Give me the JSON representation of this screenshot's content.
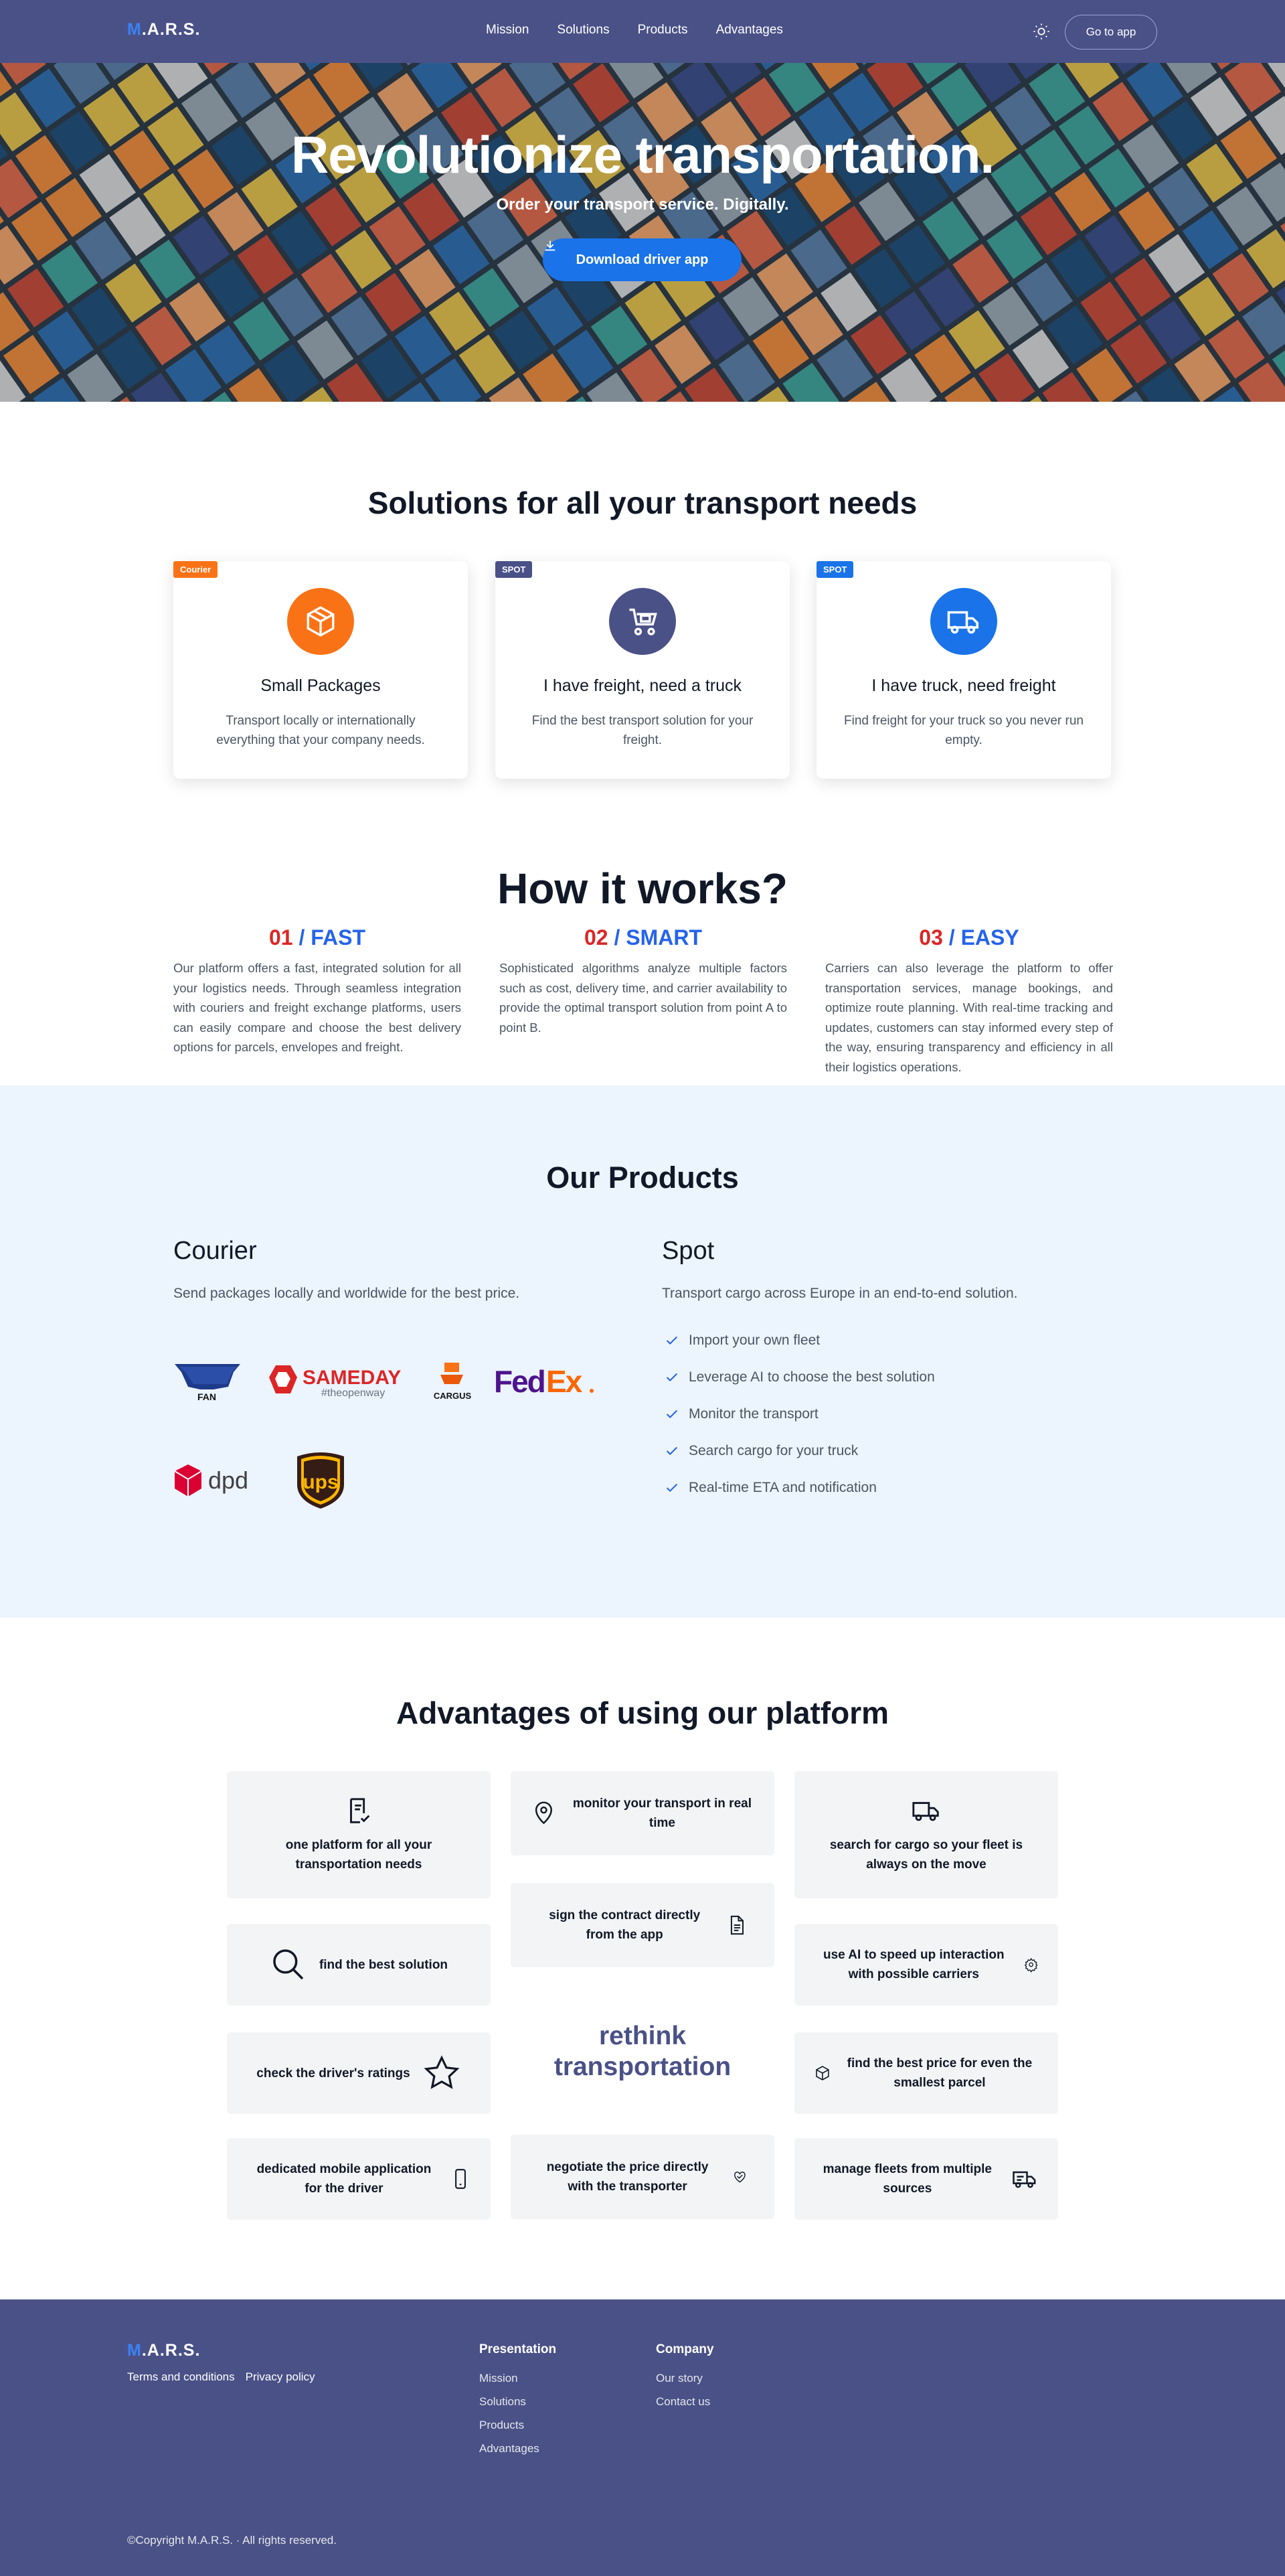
{
  "nav": {
    "logo_prefix": "M",
    "logo_rest": ".A.R.S.",
    "links": [
      "Mission",
      "Solutions",
      "Products",
      "Advantages"
    ],
    "theme_icon": "sun-icon",
    "cta": "Go to app"
  },
  "hero": {
    "title": "Revolutionize transportation.",
    "subtitle": "Order your transport service. Digitally.",
    "button": "Download driver app"
  },
  "solutions": {
    "title": "Solutions for all your transport needs",
    "cards": [
      {
        "badge": "Courier",
        "badge_color": "#f97316",
        "circle_color": "#f97316",
        "icon": "package-icon",
        "title": "Small Packages",
        "text": "Transport locally or internationally everything that your company needs."
      },
      {
        "badge": "SPOT",
        "badge_color": "#4a5187",
        "circle_color": "#4a5187",
        "icon": "cart-icon",
        "title": "I have freight, need a truck",
        "text": "Find the best transport solution for your freight."
      },
      {
        "badge": "SPOT",
        "badge_color": "#1a73e8",
        "circle_color": "#1a73e8",
        "icon": "truck-icon",
        "title": "I have truck, need freight",
        "text": "Find freight for your truck so you never run empty."
      }
    ]
  },
  "how": {
    "title": "How it works?",
    "steps": [
      {
        "num": "01",
        "label": "/ FAST",
        "text": "Our platform offers a fast, integrated solution for all your logistics needs. Through seamless integration with couriers and freight exchange platforms, users can easily compare and choose the best delivery options for parcels, envelopes and freight."
      },
      {
        "num": "02",
        "label": "/ SMART",
        "text": "Sophisticated algorithms analyze multiple factors such as cost, delivery time, and carrier availability to provide the optimal transport solution from point A to point B."
      },
      {
        "num": "03",
        "label": "/ EASY",
        "text": "Carriers can also leverage the platform to offer transportation services, manage bookings, and optimize route planning. With real-time tracking and updates, customers can stay informed every step of the way, ensuring transparency and efficiency in all their logistics operations."
      }
    ]
  },
  "products": {
    "title": "Our Products",
    "courier": {
      "title": "Courier",
      "text": "Send packages locally and worldwide for the best price.",
      "logos": {
        "fan": "FAN",
        "sameday": "SAMEDAY",
        "sameday_tag": "#theopenway",
        "cargus": "CARGUS",
        "fedex_fed": "Fed",
        "fedex_ex": "Ex",
        "dpd": "dpd",
        "ups": "ups"
      }
    },
    "spot": {
      "title": "Spot",
      "text": "Transport cargo across Europe in an end-to-end solution.",
      "features": [
        "Import your own fleet",
        "Leverage AI to choose the best solution",
        "Monitor the transport",
        "Search cargo for your truck",
        "Real-time ETA and notification"
      ]
    }
  },
  "advantages": {
    "title": "Advantages of using our platform",
    "items": [
      "one platform for all your transportation needs",
      "monitor your transport in real time",
      "search for cargo so your fleet is always on the move",
      "find the best solution",
      "sign the contract directly from the app",
      "use AI to speed up interaction with possible carriers",
      "check the driver's ratings",
      "find the best price for even the smallest parcel",
      "dedicated mobile application for the driver",
      "negotiate the price directly with the transporter",
      "manage fleets from multiple sources"
    ],
    "rethink": "rethink transportation"
  },
  "footer": {
    "logo_prefix": "M",
    "logo_rest": ".A.R.S.",
    "terms": "Terms and conditions",
    "privacy": "Privacy policy",
    "presentation_title": "Presentation",
    "presentation_links": [
      "Mission",
      "Solutions",
      "Products",
      "Advantages"
    ],
    "company_title": "Company",
    "company_links": [
      "Our story",
      "Contact us"
    ],
    "copyright": "©Copyright M.A.R.S. · All rights reserved."
  }
}
